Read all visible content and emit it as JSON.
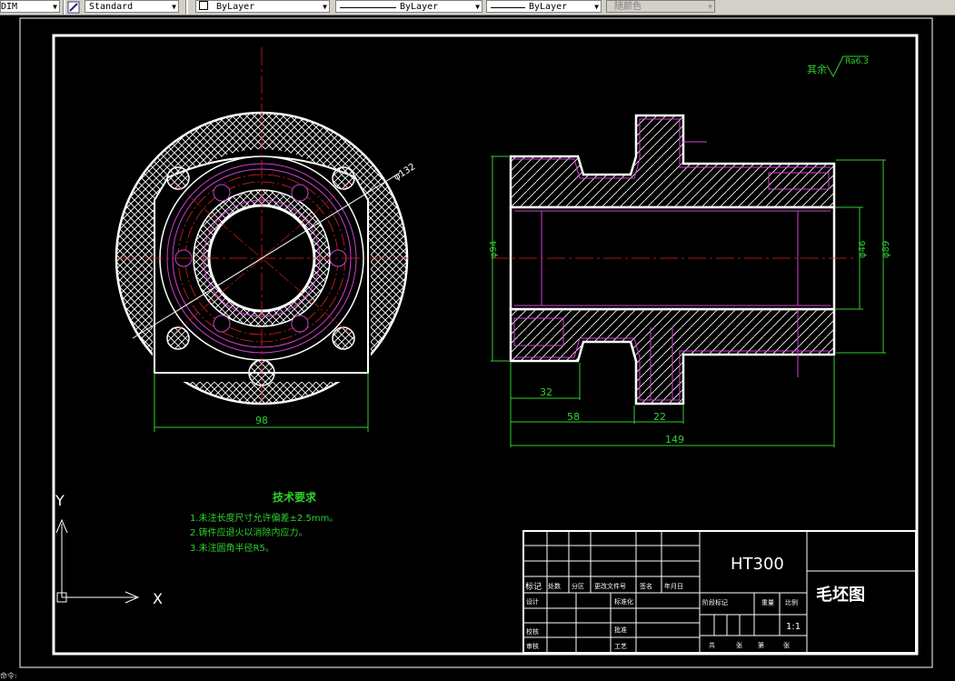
{
  "toolbar": {
    "dimstyle_name": "DIM",
    "textstyle_name": "Standard",
    "layer_value": "ByLayer",
    "linetype_value": "ByLayer",
    "lineweight_value": "ByLayer",
    "color_value": "随颜色"
  },
  "drawing": {
    "roughness_label": "其余",
    "roughness_value": "Ra6.3",
    "dim_diameter_132": "φ132",
    "dim_98": "98",
    "dim_diameter_94": "φ94",
    "dim_diameter_46": "φ46",
    "dim_diameter_89": "φ89",
    "dim_32": "32",
    "dim_58": "58",
    "dim_22": "22",
    "dim_149": "149",
    "tech_title": "技术要求",
    "tech_line_1": "1.未注长度尺寸允许偏差±2.5mm。",
    "tech_line_2": "2.铸件应退火以消除内应力。",
    "tech_line_3": "3.未注圆角半径R5。",
    "axis_y": "Y",
    "axis_x": "X"
  },
  "title_block": {
    "material": "HT300",
    "drawing_name": "毛坯图",
    "scale": "1:1",
    "mark_label": "标记",
    "row_labels": [
      "设计",
      "校核",
      "审核",
      "工艺"
    ],
    "col_labels": [
      "处数",
      "分区",
      "更改文件号",
      "签名",
      "年月日"
    ],
    "mid_labels": [
      "标准化",
      "批准"
    ],
    "stage_label": "阶段标记",
    "weight_label": "重量",
    "scale_label": "比例",
    "sheet_labels": [
      "共",
      "张",
      "第",
      "张"
    ]
  },
  "status": {
    "text": "命令:"
  }
}
